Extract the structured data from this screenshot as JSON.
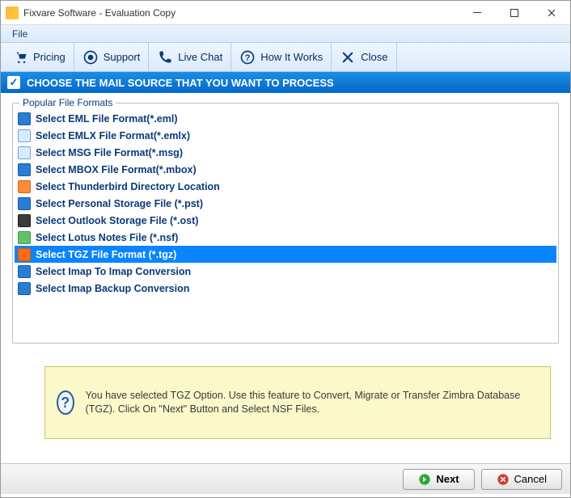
{
  "window": {
    "title": "Fixvare Software - Evaluation Copy"
  },
  "menubar": {
    "file": "File"
  },
  "toolbar": {
    "pricing": "Pricing",
    "support": "Support",
    "livechat": "Live Chat",
    "howitworks": "How It Works",
    "close": "Close"
  },
  "heading": "CHOOSE THE MAIL SOURCE THAT YOU WANT TO PROCESS",
  "group_legend": "Popular File Formats",
  "formats": [
    {
      "label": "Select EML File Format(*.eml)",
      "icon": "eml"
    },
    {
      "label": "Select EMLX File Format(*.emlx)",
      "icon": "emlx"
    },
    {
      "label": "Select MSG File Format(*.msg)",
      "icon": "msg"
    },
    {
      "label": "Select MBOX File Format(*.mbox)",
      "icon": "mbox"
    },
    {
      "label": "Select Thunderbird Directory Location",
      "icon": "thunderbird"
    },
    {
      "label": "Select Personal Storage File (*.pst)",
      "icon": "pst"
    },
    {
      "label": "Select Outlook Storage File (*.ost)",
      "icon": "ost"
    },
    {
      "label": "Select Lotus Notes File (*.nsf)",
      "icon": "nsf"
    },
    {
      "label": "Select TGZ File Format (*.tgz)",
      "icon": "tgz"
    },
    {
      "label": "Select Imap To Imap Conversion",
      "icon": "imap"
    },
    {
      "label": "Select Imap Backup Conversion",
      "icon": "imapbackup"
    }
  ],
  "selected_index": 8,
  "info_text": "You have selected TGZ Option. Use this feature to Convert, Migrate or Transfer Zimbra Database (TGZ). Click On \"Next\" Button and Select NSF Files.",
  "footer": {
    "next": "Next",
    "cancel": "Cancel"
  },
  "colors": {
    "accent": "#0a84ff",
    "toolbar_bg": "#dceafc",
    "heading_bg": "#0368c8",
    "info_bg": "#fbf8c9"
  }
}
